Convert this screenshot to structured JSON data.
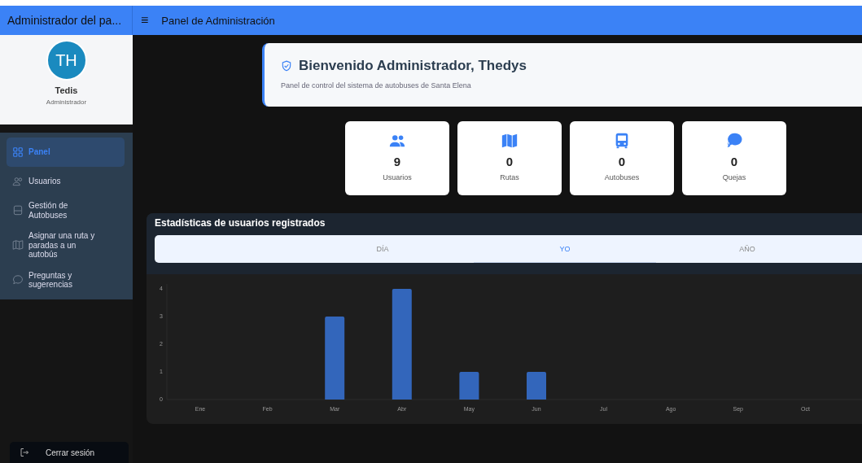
{
  "app_title": "Administrador del pa...",
  "header": {
    "menu_icon": "≡",
    "title": "Panel de Administración"
  },
  "profile": {
    "initials": "TH",
    "name": "Tedis",
    "role": "Administrador"
  },
  "sidebar": {
    "items": [
      {
        "label": "Panel",
        "selected": true
      },
      {
        "label": "Usuarios",
        "selected": false
      },
      {
        "label": "Gestión de Autobuses",
        "selected": false
      },
      {
        "label": "Asignar una ruta y paradas a un autobús",
        "selected": false
      },
      {
        "label": "Preguntas y sugerencias",
        "selected": false
      }
    ],
    "logout": "Cerrar sesión"
  },
  "welcome": {
    "title": "Bienvenido Administrador, Thedys",
    "subtitle": "Panel de control del sistema de autobuses de Santa Elena"
  },
  "stats": [
    {
      "value": "9",
      "label": "Usuarios"
    },
    {
      "value": "0",
      "label": "Rutas"
    },
    {
      "value": "0",
      "label": "Autobuses"
    },
    {
      "value": "0",
      "label": "Quejas"
    }
  ],
  "statistics": {
    "title": "Estadísticas de usuarios registrados",
    "tabs": [
      {
        "label": "DÍA",
        "selected": false
      },
      {
        "label": "YO",
        "selected": true
      },
      {
        "label": "AÑO",
        "selected": false
      }
    ],
    "chart_data": {
      "type": "bar",
      "categories": [
        "Ene",
        "Feb",
        "Mar",
        "Abr",
        "May",
        "Jun",
        "Jul",
        "Ago",
        "Sep",
        "Oct"
      ],
      "series": [
        {
          "color": "#3366bb",
          "values": [
            0,
            0,
            3,
            4,
            1,
            1,
            0,
            0,
            0,
            0
          ]
        }
      ],
      "ylim": [
        0,
        4
      ],
      "yticks": [
        0,
        1,
        2,
        3,
        4
      ]
    }
  }
}
